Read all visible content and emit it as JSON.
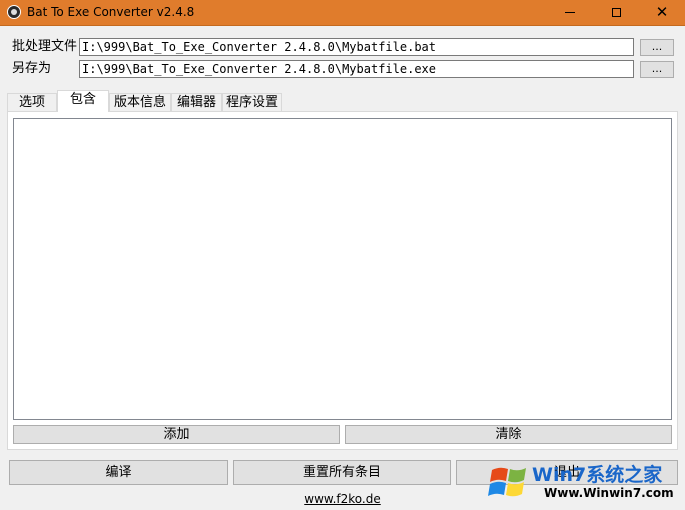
{
  "window": {
    "title": "Bat To Exe Converter v2.4.8",
    "min_label": "—",
    "max_label": "□",
    "close_label": "✕"
  },
  "files": {
    "batch_label": "批处理文件",
    "batch_value": "I:\\999\\Bat_To_Exe_Converter 2.4.8.0\\Mybatfile.bat",
    "save_label": "另存为",
    "save_value": "I:\\999\\Bat_To_Exe_Converter 2.4.8.0\\Mybatfile.exe",
    "browse_label": "..."
  },
  "tabs": [
    {
      "label": "选项"
    },
    {
      "label": "包含"
    },
    {
      "label": "版本信息"
    },
    {
      "label": "编辑器"
    },
    {
      "label": "程序设置"
    }
  ],
  "active_tab": "包含",
  "include_panel": {
    "add_label": "添加",
    "clear_label": "清除"
  },
  "actions": {
    "compile_label": "编译",
    "reset_label": "重置所有条目",
    "exit_label": "退出"
  },
  "footer": {
    "link_text": "www.f2ko.de"
  },
  "watermark": {
    "title": "Win7系统之家",
    "url": "Www.Winwin7.com"
  },
  "colors": {
    "titlebar": "#e07c2c",
    "watermark_blue": "#1a66c9"
  }
}
